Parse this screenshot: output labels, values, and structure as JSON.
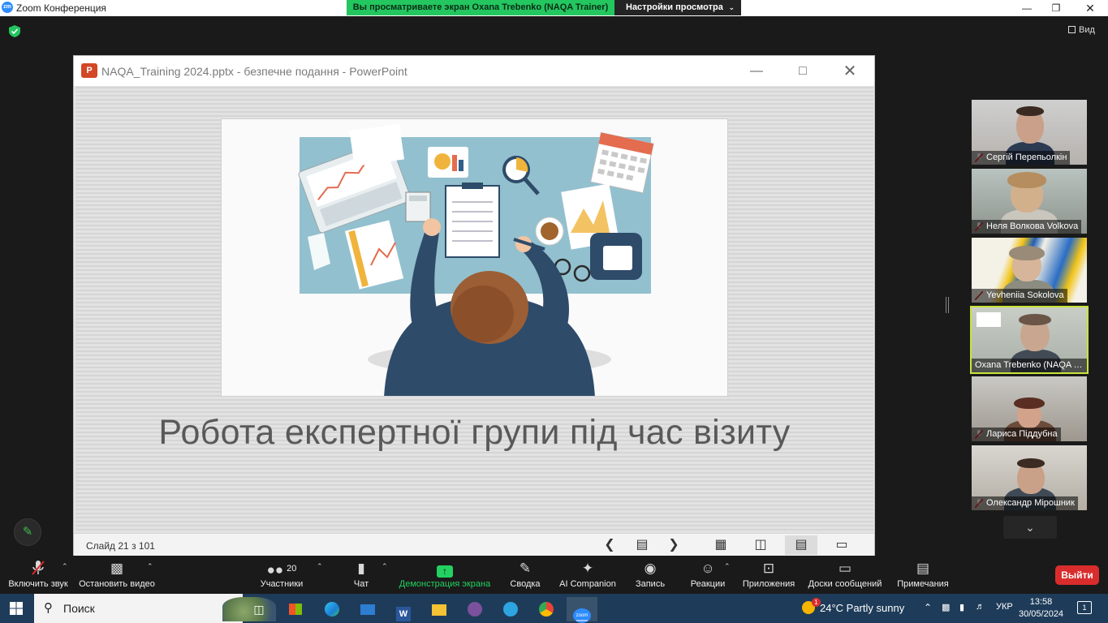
{
  "window": {
    "app_title": "Zoom Конференция",
    "zm_logo": "zm",
    "share_banner": "Вы просматриваете экран Oxana Trebenko (NAQA Trainer)",
    "view_options": "Настройки просмотра",
    "view_button": "Вид"
  },
  "powerpoint": {
    "icon_letter": "P",
    "title": "NAQA_Training 2024.pptx  -  безпечне подання - PowerPoint",
    "slide_title": "Робота експертної групи під час візиту",
    "slide_counter": "Слайд 21 з 101"
  },
  "participants": [
    {
      "name": "Сергій Перепьолкін",
      "muted": true
    },
    {
      "name": "Неля Волкова Volkova",
      "muted": true
    },
    {
      "name": "Yevheniia Sokolova",
      "muted": true
    },
    {
      "name": "Oxana Trebenko (NAQA Tr...",
      "muted": false,
      "active": true
    },
    {
      "name": "Лариса Піддубна",
      "muted": true
    },
    {
      "name": "Олександр Мірошник",
      "muted": true
    }
  ],
  "toolbar": {
    "unmute": "Включить звук",
    "start_video": "Остановить видео",
    "participants_count": "20",
    "participants": "Участники",
    "chat": "Чат",
    "share": "Демонстрация экрана",
    "summary": "Сводка",
    "ai": "AI Companion",
    "record": "Запись",
    "reactions": "Реакции",
    "apps": "Приложения",
    "whiteboards": "Доски сообщений",
    "notes": "Примечания",
    "leave": "Выйти"
  },
  "taskbar": {
    "search": "Поиск",
    "weather": "24°C  Partly sunny",
    "weather_badge": "1",
    "language": "УКР",
    "time": "13:58",
    "date": "30/05/2024",
    "notifications": "1"
  },
  "colors": {
    "share_green": "#23c65f",
    "leave_red": "#d92d2d",
    "active_speaker": "#c8e33a",
    "taskbar": "#1e3c59"
  }
}
